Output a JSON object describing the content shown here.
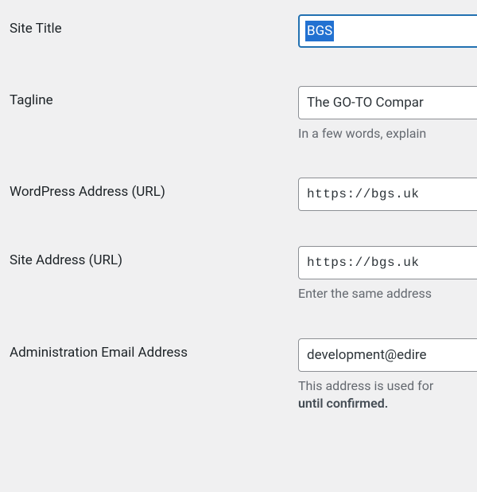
{
  "fields": {
    "site_title": {
      "label": "Site Title",
      "value": "BGS"
    },
    "tagline": {
      "label": "Tagline",
      "value": "The GO-TO Compar",
      "description": "In a few words, explain"
    },
    "wp_url": {
      "label": "WordPress Address (URL)",
      "value": "https://bgs.uk"
    },
    "site_url": {
      "label": "Site Address (URL)",
      "value": "https://bgs.uk",
      "description": "Enter the same address"
    },
    "admin_email": {
      "label": "Administration Email Address",
      "value": "development@edire",
      "description_pre": "This address is used for",
      "description_strong": "until confirmed."
    }
  }
}
